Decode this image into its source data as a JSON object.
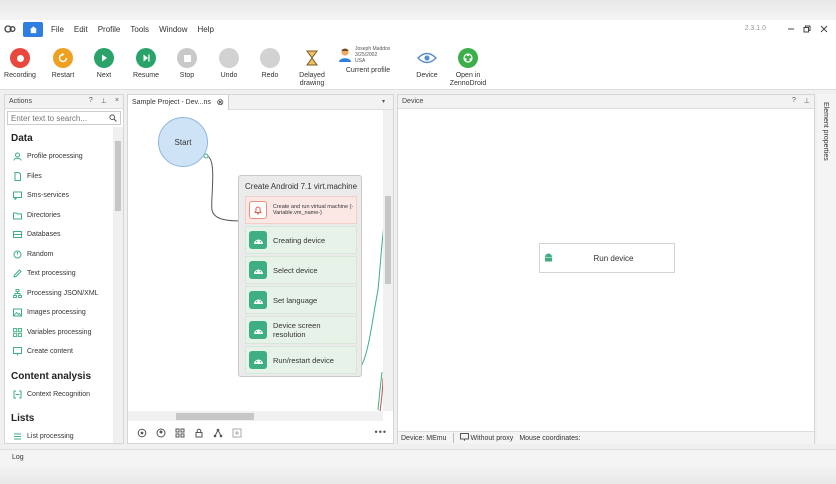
{
  "menu": {
    "items": [
      "File",
      "Edit",
      "Profile",
      "Tools",
      "Window",
      "Help"
    ],
    "version": "2.3.1.0"
  },
  "toolbar": {
    "recording": "Recording",
    "restart": "Restart",
    "next": "Next",
    "resume": "Resume",
    "stop": "Stop",
    "undo": "Undo",
    "redo": "Redo",
    "delayed_1": "Delayed",
    "delayed_2": "drawing",
    "profile_name": "Joseph Maddox",
    "profile_date": "3/25/2002",
    "profile_country": "USA",
    "current_profile": "Current profile",
    "device": "Device",
    "open_1": "Open in",
    "open_2": "ZennoDroid"
  },
  "actions": {
    "title": "Actions",
    "search_placeholder": "Enter text to search...",
    "categories": {
      "data": "Data",
      "content_analysis": "Content analysis",
      "lists": "Lists"
    },
    "items": {
      "profile_processing": "Profile processing",
      "files": "Files",
      "sms_services": "Sms-services",
      "directories": "Directories",
      "databases": "Databases",
      "random": "Random",
      "text_processing": "Text processing",
      "json_xml": "Processing JSON/XML",
      "images_processing": "Images processing",
      "variables_processing": "Variables processing",
      "create_content": "Create content",
      "context_recognition": "Context Recognition",
      "list_processing": "List processing"
    }
  },
  "canvas": {
    "tab_label": "Sample Project - Dev...ns",
    "start": "Start",
    "group_title": "Create Android 7.1 virt.machine",
    "steps": {
      "alert": "Create and run virtual machine {-Variable.vm_name-}",
      "creating": "Creating device",
      "select": "Select device",
      "language": "Set language",
      "resolution_1": "Device screen",
      "resolution_2": "resolution",
      "run": "Run/restart device"
    }
  },
  "device_panel": {
    "title": "Device",
    "node_label": "Run device",
    "status_device": "Device: MEmu",
    "status_proxy": "Without proxy",
    "status_mouse": "Mouse coordinates:"
  },
  "side_strip": {
    "label": "Element properties"
  },
  "log": {
    "label": "Log"
  },
  "colors": {
    "accent": "#2f7fe0",
    "record_red": "#e8483e",
    "restart_orange": "#f0a020",
    "next_green": "#2aa36b",
    "step_green": "#3fae82"
  }
}
